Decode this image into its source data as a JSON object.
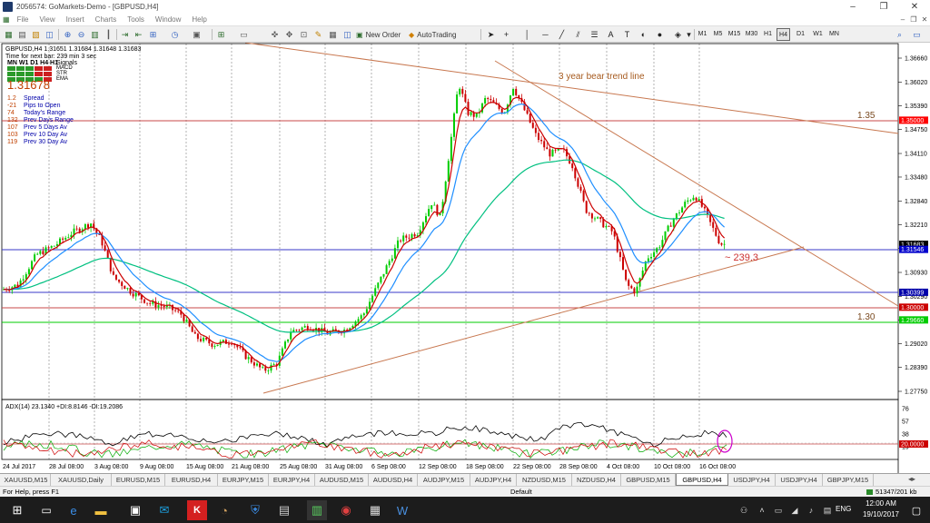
{
  "window": {
    "title": "2056574: GoMarkets-Demo - [GBPUSD,H4]",
    "controls": [
      "–",
      "❐",
      "✕"
    ]
  },
  "menu": {
    "items": [
      "File",
      "View",
      "Insert",
      "Charts",
      "Tools",
      "Window",
      "Help"
    ]
  },
  "toolbar": {
    "new_order": "New Order",
    "autotrading": "AutoTrading",
    "timeframes": [
      "M1",
      "M5",
      "M15",
      "M30",
      "H1",
      "H4",
      "D1",
      "W1",
      "MN"
    ],
    "active_tf": "H4"
  },
  "chart": {
    "header": "GBPUSD,H4  1.31651 1.31684 1.31648 1.31683",
    "timer": "Time for next bar: 239 min 3 sec",
    "mtf_labels": "MN W1 D1 H4 H1",
    "signals_label": "Signals",
    "ind_labels": [
      "MACD",
      "STR",
      "EMA"
    ],
    "big_price": "1.31678",
    "stats": [
      {
        "value": "1.2",
        "label": "Spread"
      },
      {
        "value": "-21",
        "label": "Pips to Open"
      },
      {
        "value": "74",
        "label": "Today's Range"
      },
      {
        "value": "132",
        "label": "Prev Days Range"
      },
      {
        "value": "107",
        "label": "Prev 5 Days Av"
      },
      {
        "value": "103",
        "label": "Prev 10 Day Av"
      },
      {
        "value": "119",
        "label": "Prev 30 Day Av"
      }
    ],
    "annotation_trend": "3 year bear trend line",
    "annotation_135": "1.35",
    "annotation_130": "1.30",
    "annotation_239": "~ 239.3",
    "price_ticks": [
      "1.36660",
      "1.36020",
      "1.35390",
      "1.34750",
      "1.34110",
      "1.33480",
      "1.32840",
      "1.32210",
      "1.31570",
      "1.30930",
      "1.30290",
      "1.29660",
      "1.29020",
      "1.28390",
      "1.27750"
    ],
    "price_tags": [
      {
        "text": "1.35000",
        "bg": "#ff0000"
      },
      {
        "text": "1.31683",
        "bg": "#000000"
      },
      {
        "text": "1.31546",
        "bg": "#0000cc"
      },
      {
        "text": "1.30399",
        "bg": "#0000aa"
      },
      {
        "text": "1.30000",
        "bg": "#cc0000"
      },
      {
        "text": "1.29660",
        "bg": "#00cc00"
      }
    ],
    "time_ticks": [
      "24 Jul 2017",
      "28 Jul 08:00",
      "3 Aug 08:00",
      "9 Aug 08:00",
      "15 Aug 08:00",
      "21 Aug 08:00",
      "25 Aug 08:00",
      "31 Aug 08:00",
      "6 Sep 08:00",
      "12 Sep 08:00",
      "18 Sep 08:00",
      "22 Sep 08:00",
      "28 Sep 08:00",
      "4 Oct 08:00",
      "10 Oct 08:00",
      "16 Oct 08:00"
    ],
    "adx_header": "ADX(14) 23.1340  +DI:8.8146  -DI:19.2086",
    "adx_ticks": [
      "76",
      "57",
      "38",
      "19"
    ],
    "adx_tag": "20.0000",
    "colors": {
      "bull": "#00cc00",
      "bear": "#cc0000",
      "ema_fast": "#cc0000",
      "ema_mid": "#1f8fff",
      "ema_slow": "#00c080",
      "trendline": "#c87850",
      "annotation": "#a65a1e"
    }
  },
  "tabs": [
    "XAUUSD,M15",
    "XAUUSD,Daily",
    "EURUSD,M15",
    "EURUSD,H4",
    "EURJPY,M15",
    "EURJPY,H4",
    "AUDUSD,M15",
    "AUDUSD,H4",
    "AUDJPY,M15",
    "AUDJPY,H4",
    "NZDUSD,M15",
    "NZDUSD,H4",
    "GBPUSD,M15",
    "GBPUSD,H4",
    "USDJPY,H4",
    "USDJPY,H4",
    "GBPJPY,M15"
  ],
  "active_tab": "GBPUSD,H4",
  "status": {
    "help": "For Help, press F1",
    "profile": "Default",
    "traffic": "51347/201 kb"
  },
  "taskbar": {
    "lang": "ENG",
    "time": "12:00 AM",
    "date": "19/10/2017"
  }
}
